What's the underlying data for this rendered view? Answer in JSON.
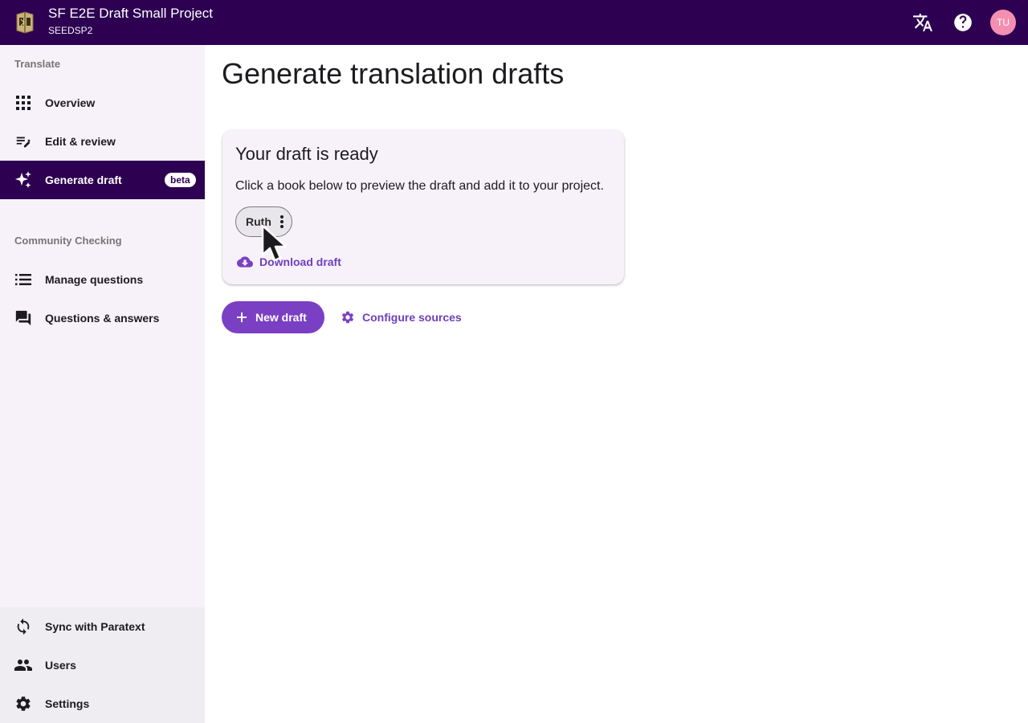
{
  "header": {
    "project_title": "SF E2E Draft Small Project",
    "project_code": "SEEDSP2",
    "avatar_initials": "TU",
    "icons": [
      "app-logo-icon",
      "translate-language-icon",
      "help-icon"
    ],
    "colors": {
      "bar": "#2d0052",
      "avatar": "#f48fb1"
    }
  },
  "sidebar": {
    "translate_section": "Translate",
    "community_section": "Community Checking",
    "items": {
      "overview": "Overview",
      "edit_review": "Edit & review",
      "generate_draft": "Generate draft",
      "generate_draft_badge": "beta",
      "manage_questions": "Manage questions",
      "questions_answers": "Questions & answers",
      "sync": "Sync with Paratext",
      "users": "Users",
      "settings": "Settings"
    },
    "active_item": "generate_draft"
  },
  "main": {
    "page_title": "Generate translation drafts",
    "card": {
      "title": "Your draft is ready",
      "text": "Click a book below to preview the draft and add it to your project.",
      "book_chip": "Ruth",
      "download_label": "Download draft"
    },
    "new_draft_label": "New draft",
    "configure_sources_label": "Configure sources",
    "accent_color": "#7b3fc4"
  }
}
